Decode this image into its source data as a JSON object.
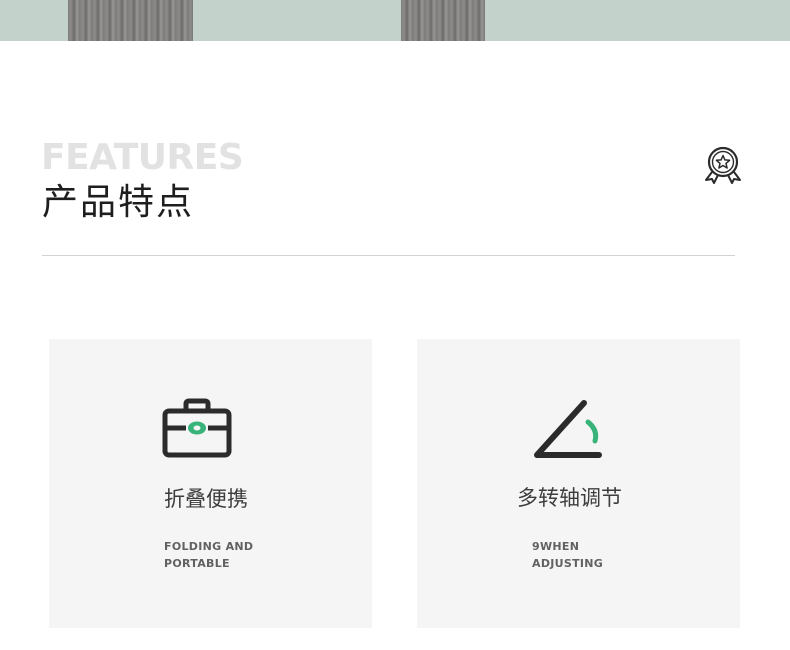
{
  "header": {
    "title_en": "FEATURES",
    "title_cn": "产品特点",
    "badge_icon": "award-star-icon"
  },
  "colors": {
    "accent": "#38b37a",
    "dark": "#2b2b2b",
    "card_bg": "#f5f5f5",
    "top_bg": "#c3d2cb"
  },
  "features": [
    {
      "icon": "briefcase-icon",
      "title": "折叠便携",
      "subtitle_lines": [
        "FOLDING AND",
        "PORTABLE"
      ]
    },
    {
      "icon": "angle-icon",
      "title": "多转轴调节",
      "subtitle_lines": [
        "9WHEN",
        "ADJUSTING"
      ]
    }
  ]
}
